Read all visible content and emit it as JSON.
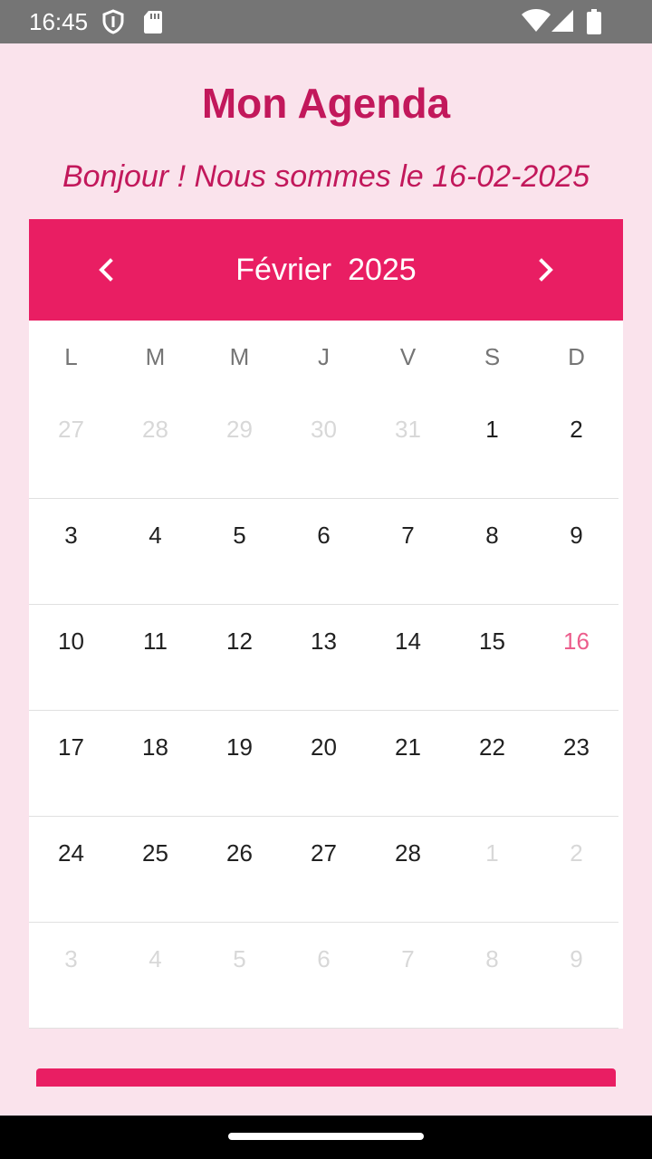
{
  "status_bar": {
    "time": "16:45",
    "icons": [
      "shield-icon",
      "sd-card-icon",
      "wifi-icon",
      "signal-icon",
      "battery-icon"
    ]
  },
  "app": {
    "title": "Mon Agenda",
    "greeting": "Bonjour ! Nous sommes le 16-02-2025"
  },
  "calendar": {
    "month": "Février",
    "year": "2025",
    "prev_icon": "chevron-left-icon",
    "next_icon": "chevron-right-icon",
    "weekdays": [
      "L",
      "M",
      "M",
      "J",
      "V",
      "S",
      "D"
    ],
    "weeks": [
      [
        {
          "d": "27",
          "state": "outside"
        },
        {
          "d": "28",
          "state": "outside"
        },
        {
          "d": "29",
          "state": "outside"
        },
        {
          "d": "30",
          "state": "outside"
        },
        {
          "d": "31",
          "state": "outside"
        },
        {
          "d": "1",
          "state": "current"
        },
        {
          "d": "2",
          "state": "current"
        }
      ],
      [
        {
          "d": "3",
          "state": "current"
        },
        {
          "d": "4",
          "state": "current"
        },
        {
          "d": "5",
          "state": "current"
        },
        {
          "d": "6",
          "state": "current"
        },
        {
          "d": "7",
          "state": "current"
        },
        {
          "d": "8",
          "state": "current"
        },
        {
          "d": "9",
          "state": "current"
        }
      ],
      [
        {
          "d": "10",
          "state": "current"
        },
        {
          "d": "11",
          "state": "current"
        },
        {
          "d": "12",
          "state": "current"
        },
        {
          "d": "13",
          "state": "current"
        },
        {
          "d": "14",
          "state": "current"
        },
        {
          "d": "15",
          "state": "current"
        },
        {
          "d": "16",
          "state": "today"
        }
      ],
      [
        {
          "d": "17",
          "state": "current"
        },
        {
          "d": "18",
          "state": "current"
        },
        {
          "d": "19",
          "state": "current"
        },
        {
          "d": "20",
          "state": "current"
        },
        {
          "d": "21",
          "state": "current"
        },
        {
          "d": "22",
          "state": "current"
        },
        {
          "d": "23",
          "state": "current"
        }
      ],
      [
        {
          "d": "24",
          "state": "current"
        },
        {
          "d": "25",
          "state": "current"
        },
        {
          "d": "26",
          "state": "current"
        },
        {
          "d": "27",
          "state": "current"
        },
        {
          "d": "28",
          "state": "current"
        },
        {
          "d": "1",
          "state": "outside"
        },
        {
          "d": "2",
          "state": "outside"
        }
      ],
      [
        {
          "d": "3",
          "state": "outside"
        },
        {
          "d": "4",
          "state": "outside"
        },
        {
          "d": "5",
          "state": "outside"
        },
        {
          "d": "6",
          "state": "outside"
        },
        {
          "d": "7",
          "state": "outside"
        },
        {
          "d": "8",
          "state": "outside"
        },
        {
          "d": "9",
          "state": "outside"
        }
      ]
    ]
  },
  "colors": {
    "background": "#fae3ec",
    "accent": "#e91e63",
    "title": "#c2185b",
    "today": "#ec5d8c"
  }
}
